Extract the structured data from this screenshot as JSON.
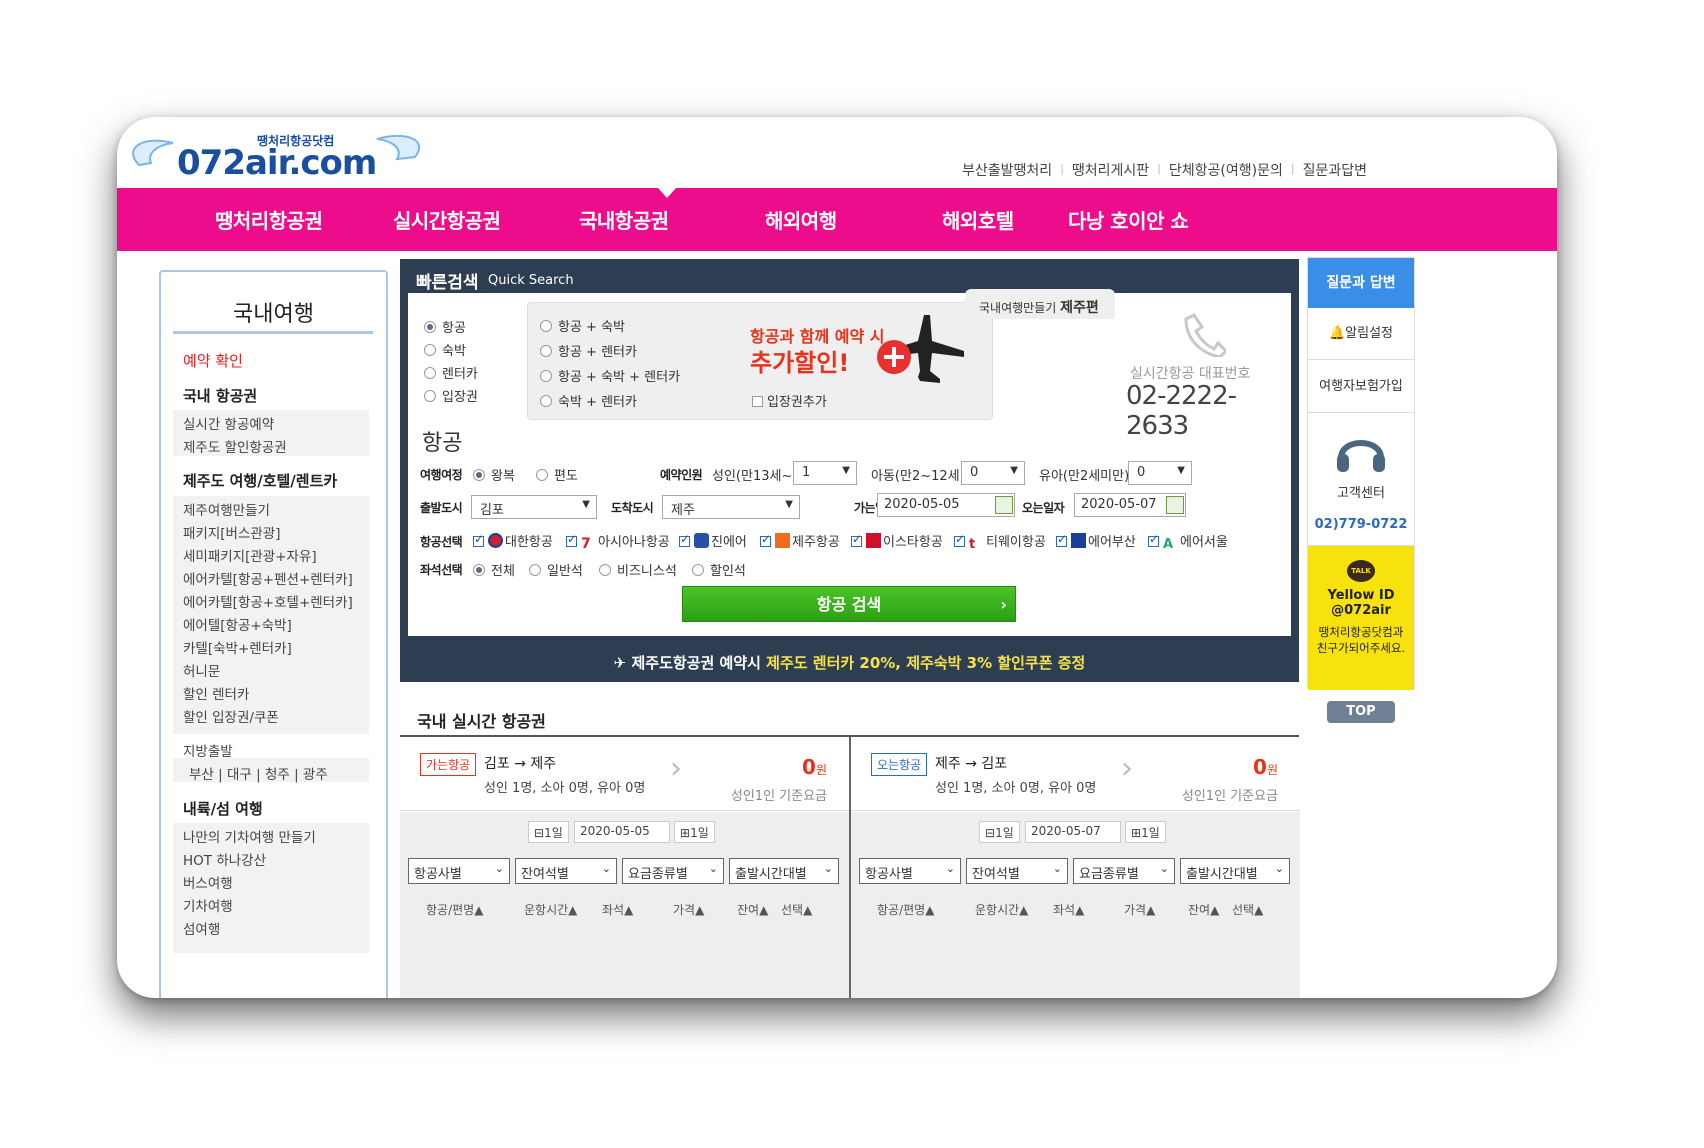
{
  "header": {
    "logo_text": "072air.com",
    "logo_sub": "땡처리항공닷컴",
    "top_links": [
      "부산출발땡처리",
      "땡처리게시판",
      "단체항공(여행)문의",
      "질문과답변"
    ]
  },
  "gnb": [
    "땡처리항공권",
    "실시간항공권",
    "국내항공권",
    "해외여행",
    "해외호텔",
    "다낭 호이안 쇼"
  ],
  "left": {
    "title": "국내여행",
    "reservation": "예약 확인",
    "sec1": "국내 항공권",
    "sec1_items": [
      "실시간 항공예약",
      "제주도 할인항공권"
    ],
    "sec2": "제주도 여행/호텔/렌트카",
    "sec2_items": [
      "제주여행만들기",
      "패키지[버스관광]",
      "세미패키지[관광+자유]",
      "에어카텔[항공+펜션+렌터카]",
      "에어카텔[항공+호텔+렌터카]",
      "에어텔[항공+숙박]",
      "카텔[숙박+렌터카]",
      "허니문",
      "할인 렌터카",
      "할인 입장권/쿠폰"
    ],
    "local": "지방출발",
    "local_cities": "부산 | 대구 | 청주 | 광주",
    "sec3": "내륙/섬 여행",
    "sec3_items": [
      "나만의 기차여행 만들기",
      "HOT 하나강산",
      "버스여행",
      "기차여행",
      "섬여행"
    ]
  },
  "quick": {
    "title": "빠른검색",
    "subtitle": "Quick Search",
    "types": [
      "항공",
      "숙박",
      "렌터카",
      "입장권"
    ],
    "combos": [
      "항공 + 숙박",
      "항공 + 렌터카",
      "항공 + 숙박 + 렌터카",
      "숙박 + 렌터카"
    ],
    "tag_pre": "국내여행만들기",
    "tag_bold": "제주편",
    "promo1": "항공과 함께 예약 시",
    "promo2": "추가할인!",
    "ticket_add": "입장권추가",
    "rep_label": "실시간항공 대표번호",
    "rep_phone": "02-2222-2633",
    "section": "항공",
    "trip_label": "여행여정",
    "trip_round": "왕복",
    "trip_one": "편도",
    "pax_label": "예약인원",
    "adult_label": "성인(만13세~)",
    "adult_val": "1",
    "child_label": "아동(만2~12세)",
    "child_val": "0",
    "infant_label": "유아(만2세미만)",
    "infant_val": "0",
    "dep_label": "출발도시",
    "dep_val": "김포",
    "arr_label": "도착도시",
    "arr_val": "제주",
    "go_label": "가는일자",
    "go_date": "2020-05-05",
    "back_label": "오는일자",
    "back_date": "2020-05-07",
    "air_label": "항공선택",
    "airlines": [
      "대한항공",
      "아시아나항공",
      "진에어",
      "제주항공",
      "이스타항공",
      "티웨이항공",
      "에어부산",
      "에어서울"
    ],
    "seat_label": "좌석선택",
    "seats": [
      "전체",
      "일반석",
      "비즈니스석",
      "할인석"
    ],
    "search_btn": "항공 검색",
    "banner_pre": "제주도항공권 예약시",
    "banner_hl": "제주도 렌터카 20%, 제주숙박 3% 할인쿠폰 증정"
  },
  "right": {
    "qa": "질문과 답변",
    "alarm": "알림설정",
    "insurance": "여행자보험가입",
    "cs": "고객센터",
    "cs_phone": "02)779-0722",
    "talk": "TALK",
    "yellow1": "Yellow ID",
    "yellow2": "@072air",
    "yellow3": "땡처리항공닷컴과",
    "yellow4": "친구가되어주세요.",
    "top": "TOP"
  },
  "realtime": {
    "title": "국내 실시간 항공권",
    "legs": [
      {
        "badge": "가는항공",
        "route": "김포 → 제주",
        "pax": "성인 1명, 소아 0명, 유아 0명",
        "price": "0",
        "unit": "원",
        "basis": "성인1인 기준요금",
        "minus": "1일",
        "date": "2020-05-05",
        "plus": "1일"
      },
      {
        "badge": "오는항공",
        "route": "제주 → 김포",
        "pax": "성인 1명, 소아 0명, 유아 0명",
        "price": "0",
        "unit": "원",
        "basis": "성인1인 기준요금",
        "minus": "1일",
        "date": "2020-05-07",
        "plus": "1일"
      }
    ],
    "filters": [
      "항공사별",
      "잔여석별",
      "요금종류별",
      "출발시간대별"
    ],
    "cols": [
      "항공/편명▲",
      "운항시간▲",
      "좌석▲",
      "가격▲",
      "잔여▲",
      "선택▲"
    ]
  },
  "colors": {
    "gnb": "#ec0c8c",
    "quick": "#2d3e52",
    "accent": "#3a8ee6",
    "price": "#e8331c",
    "search": "#3bb21d",
    "yellow": "#f8e20e"
  }
}
